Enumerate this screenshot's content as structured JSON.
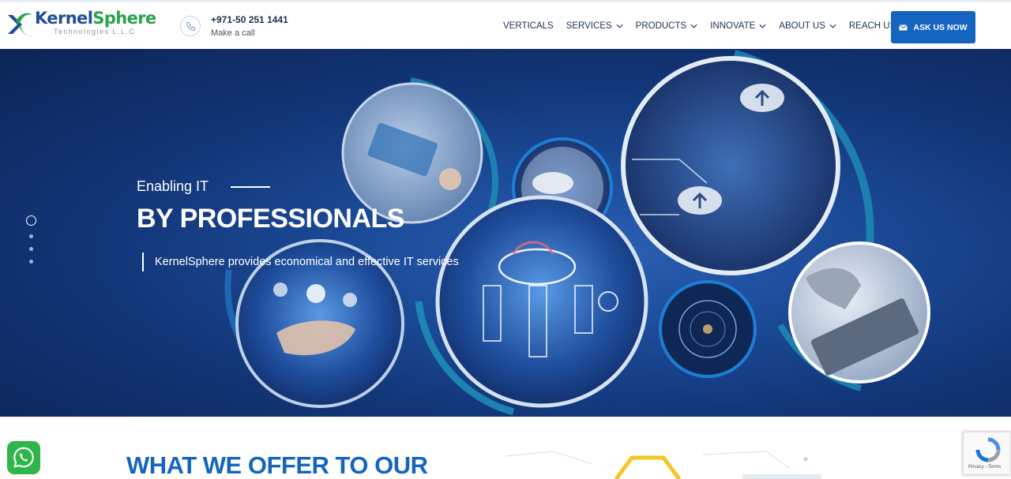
{
  "brand": {
    "name_part1": "Kernel",
    "name_part2": "Sphere",
    "sub": "Technologies L.L.C"
  },
  "contact": {
    "phone": "+971-50 251 1441",
    "label": "Make a call"
  },
  "nav": {
    "items": [
      {
        "label": "VERTICALS",
        "has_dropdown": false
      },
      {
        "label": "SERVICES",
        "has_dropdown": true
      },
      {
        "label": "PRODUCTS",
        "has_dropdown": true
      },
      {
        "label": "INNOVATE",
        "has_dropdown": true
      },
      {
        "label": "ABOUT US",
        "has_dropdown": true
      },
      {
        "label": "REACH US",
        "has_dropdown": true
      }
    ]
  },
  "cta": {
    "label": "ASK US NOW",
    "icon": "envelope-icon"
  },
  "hero": {
    "kicker": "Enabling IT",
    "title": "BY PROFESSIONALS",
    "description": "KernelSphere provides economical and effective IT services",
    "slides_total": 4,
    "slide_active": 1
  },
  "section": {
    "title": "WHAT WE OFFER TO OUR"
  },
  "widgets": {
    "whatsapp_icon": "whatsapp-icon",
    "recaptcha_links": "Privacy - Terms"
  },
  "colors": {
    "brand_blue": "#1565c0",
    "brand_green": "#2aa24b",
    "navy_text": "#1c2f52",
    "whatsapp_green": "#2fb54a"
  }
}
